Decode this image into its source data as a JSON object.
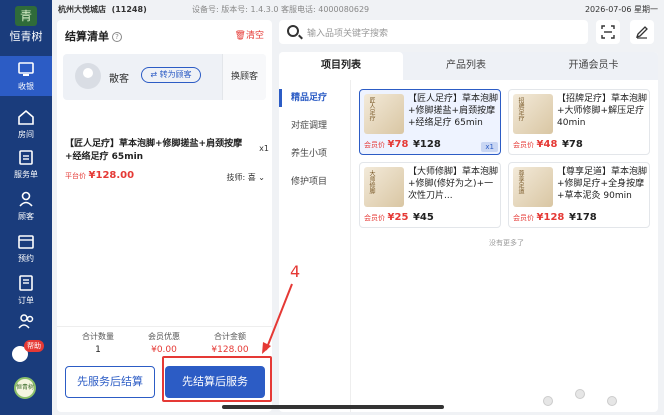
{
  "status_bar": {
    "store": "杭州大悦城店",
    "store_id": "(11248)",
    "device": "设备号: 版本号: 1.4.3.0  客服电话: 4000080629",
    "datetime": "2026-07-06 星期一"
  },
  "brand": {
    "logo_mark": "青",
    "name": "恒青树"
  },
  "sidebar": {
    "items": [
      {
        "label": "收银"
      },
      {
        "label": "房间"
      },
      {
        "label": "服务单"
      },
      {
        "label": "顾客"
      },
      {
        "label": "预约"
      },
      {
        "label": "订单"
      },
      {
        "label": "员工"
      }
    ],
    "help_badge": "帮助",
    "avatar_text": "恒青树"
  },
  "cart": {
    "title": "结算清单",
    "help_icon": "?",
    "clear_label": "清空",
    "customer_name": "散客",
    "to_member_label": "转为顾客",
    "swap_label": "换顾客",
    "item": {
      "title": "【匠人足疗】草本泡脚+修脚搓盐+肩颈按摩+经络足疗 65min",
      "qty": "x1",
      "price_label": "平台价",
      "price": "¥128.00",
      "tech_label": "技师:",
      "tech_value": "喜"
    },
    "summary": {
      "count_label": "合计数量",
      "count": "1",
      "discount_label": "会员优惠",
      "discount": "¥0.00",
      "total_label": "合计金额",
      "total": "¥128.00"
    },
    "btn_later": "先服务后结算",
    "btn_first": "先结算后服务"
  },
  "search": {
    "placeholder": "输入品项关键字搜索"
  },
  "tabs": [
    "项目列表",
    "产品列表",
    "开通会员卡"
  ],
  "categories": [
    "精品足疗",
    "对症调理",
    "养生小项",
    "修护项目"
  ],
  "products": [
    {
      "title": "【匠人足疗】草本泡脚+修脚搓盐+肩颈按摩+经络足疗 65min",
      "thumb": "匠人足疗",
      "member_label": "会员价",
      "member_price": "¥78",
      "price": "¥128",
      "qty": "x1",
      "selected": true
    },
    {
      "title": "【招牌足疗】草本泡脚+大师修脚+解压足疗 40min",
      "thumb": "招牌足疗",
      "member_label": "会员价",
      "member_price": "¥48",
      "price": "¥78",
      "qty": "",
      "selected": false
    },
    {
      "title": "【大师修脚】草本泡脚+修脚(修好为之)+一次性刀片...",
      "thumb": "大师修脚",
      "member_label": "会员价",
      "member_price": "¥25",
      "price": "¥45",
      "qty": "",
      "selected": false
    },
    {
      "title": "【尊享足道】草本泡脚+修脚足疗+全身按摩+草本泥灸 90min",
      "thumb": "尊享足道",
      "member_label": "会员价",
      "member_price": "¥128",
      "price": "¥178",
      "qty": "",
      "selected": false
    }
  ],
  "no_more": "没有更多了",
  "annotation": {
    "step": "4"
  },
  "colors": {
    "primary": "#2c5cc5",
    "sidebar": "#1a3c7c",
    "accent_red": "#e53935"
  }
}
